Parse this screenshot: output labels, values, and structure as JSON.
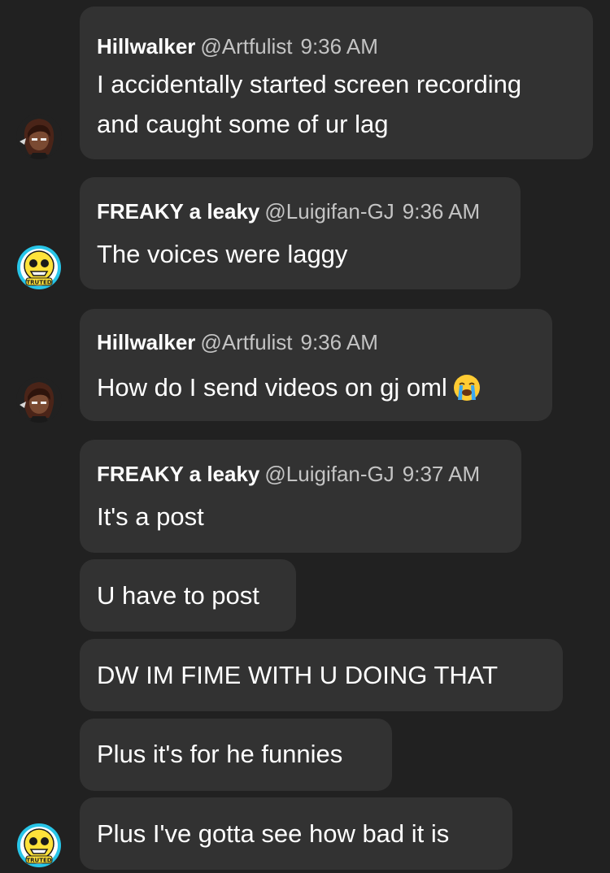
{
  "messages": [
    {
      "author": "Hillwalker",
      "handle": "@Artfulist",
      "time": "9:36 AM",
      "lines": [
        "I accidentally started screen recording",
        "and caught some of ur lag"
      ]
    },
    {
      "author": "FREAKY a leaky",
      "handle": "@Luigifan-GJ",
      "time": "9:36 AM",
      "lines": [
        "The voices were laggy"
      ]
    },
    {
      "author": "Hillwalker",
      "handle": "@Artfulist",
      "time": "9:36 AM",
      "lines": [
        "How do I send videos on gj oml"
      ],
      "emoji": "loudly-crying-face-icon"
    },
    {
      "author": "FREAKY a leaky",
      "handle": "@Luigifan-GJ",
      "time": "9:37 AM",
      "lines": [
        "It's a post"
      ]
    },
    {
      "lines": [
        "U have to post"
      ]
    },
    {
      "lines": [
        "DW IM FIME WITH U DOING THAT"
      ]
    },
    {
      "lines": [
        "Plus it's for he funnies"
      ]
    },
    {
      "lines": [
        "Plus I've gotta see how bad it is"
      ]
    }
  ],
  "avatars": {
    "hillwalker": {
      "icon": "dark-haired-character-avatar-icon"
    },
    "freaky": {
      "icon": "yellow-skull-avatar-icon",
      "badge_text": "TRUTED"
    }
  },
  "colors": {
    "background": "#212121",
    "bubble": "#323232",
    "text": "#ffffff",
    "meta": "#c4c4c4"
  }
}
